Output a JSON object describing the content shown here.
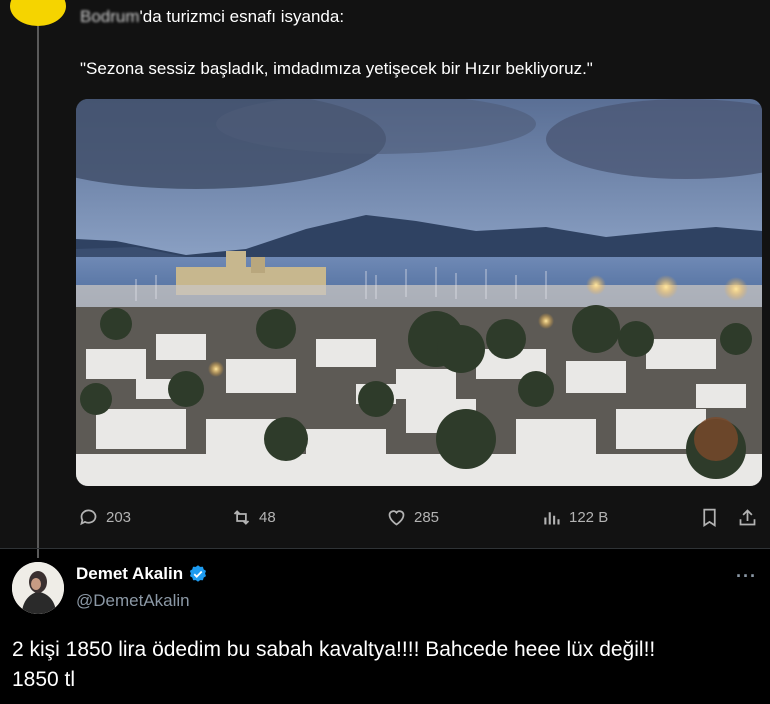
{
  "quoted_post": {
    "header_blurred": "Bodrum",
    "header_text": "'da turizmci esnafı isyanda:",
    "quote": "\"Sezona sessiz başladık, imdadımıza yetişecek bir Hızır bekliyoruz.\"",
    "image_icon": "bodrum-harbor-photo",
    "actions": {
      "replies": "203",
      "reposts": "48",
      "likes": "285",
      "views": "122 B"
    }
  },
  "reply_post": {
    "display_name": "Demet Akalin",
    "handle": "@DemetAkalin",
    "verified": true,
    "verified_color": "#1d9bf0",
    "more": "···",
    "text_line1": "2 kişi 1850 lira ödedim bu sabah kavaltya!!!! Bahcede heee lüx değil!!",
    "text_line2": "1850 tl"
  },
  "colors": {
    "background_top": "#121212",
    "background_bottom": "#000000",
    "text": "#ffffff",
    "muted": "#8b98a5",
    "accent_yellow": "#f5d400"
  }
}
